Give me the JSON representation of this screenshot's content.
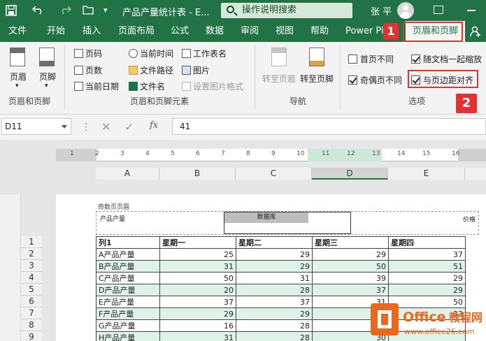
{
  "titlebar": {
    "title": "产品产量统计表 - E...",
    "search": "操作说明搜索",
    "user": "张 平"
  },
  "tabs": [
    "文件",
    "开始",
    "插入",
    "页面布局",
    "公式",
    "数据",
    "审阅",
    "视图",
    "帮助",
    "Power Pi",
    "页眉和页脚"
  ],
  "callouts": [
    "1",
    "2"
  ],
  "ribbon": {
    "group1": {
      "header": "页眉",
      "footer": "页脚",
      "label": "页眉和页脚"
    },
    "group2": {
      "items": [
        "页码",
        "页数",
        "当前日期",
        "当前时间",
        "文件路径",
        "文件名",
        "工作表名",
        "图片",
        "设置图片格式"
      ],
      "label": "页眉和页脚元素"
    },
    "group3": {
      "to_header": "转至页眉",
      "to_footer": "转至页脚",
      "label": "导航"
    },
    "group4": {
      "options": [
        {
          "label": "首页不同",
          "checked": false
        },
        {
          "label": "随文档一起缩放",
          "checked": true
        },
        {
          "label": "奇偶页不同",
          "checked": true
        },
        {
          "label": "与页边距对齐",
          "checked": true
        }
      ],
      "label": "选项"
    }
  },
  "formula": {
    "namebox": "D11",
    "value": "41",
    "fx": "fx"
  },
  "ruler_numbers": [
    "1",
    "2",
    "3",
    "4",
    "5",
    "6",
    "7",
    "8",
    "9",
    "10",
    "11",
    "12",
    "13",
    "14",
    "15",
    "16"
  ],
  "columns": [
    "A",
    "B",
    "C",
    "D",
    "E"
  ],
  "page_header": {
    "label": "奇数页页眉",
    "left": "产品产量",
    "center": "数据库",
    "right": "价格"
  },
  "rows": [
    {
      "n": "1",
      "cells": [
        "列1",
        "星期一",
        "星期二",
        "星期三",
        "星期四"
      ]
    },
    {
      "n": "2",
      "cells": [
        "A产品产量",
        "25",
        "29",
        "29",
        "37"
      ]
    },
    {
      "n": "3",
      "cells": [
        "B产品产量",
        "31",
        "29",
        "50",
        "51"
      ]
    },
    {
      "n": "4",
      "cells": [
        "C产品产量",
        "50",
        "31",
        "39",
        "29"
      ]
    },
    {
      "n": "5",
      "cells": [
        "D产品产量",
        "20",
        "28",
        "37",
        "29"
      ]
    },
    {
      "n": "6",
      "cells": [
        "E产品产量",
        "37",
        "37",
        "31",
        "50"
      ]
    },
    {
      "n": "7",
      "cells": [
        "F产品产量",
        "29",
        "29",
        "29",
        "33"
      ]
    },
    {
      "n": "8",
      "cells": [
        "G产品产量",
        "16",
        "28",
        "29",
        ""
      ]
    },
    {
      "n": "9",
      "cells": [
        "H产品产量",
        "31",
        "28",
        "30",
        ""
      ]
    }
  ],
  "watermark": {
    "brand": "Office教程网",
    "url": "www.office26.com"
  }
}
